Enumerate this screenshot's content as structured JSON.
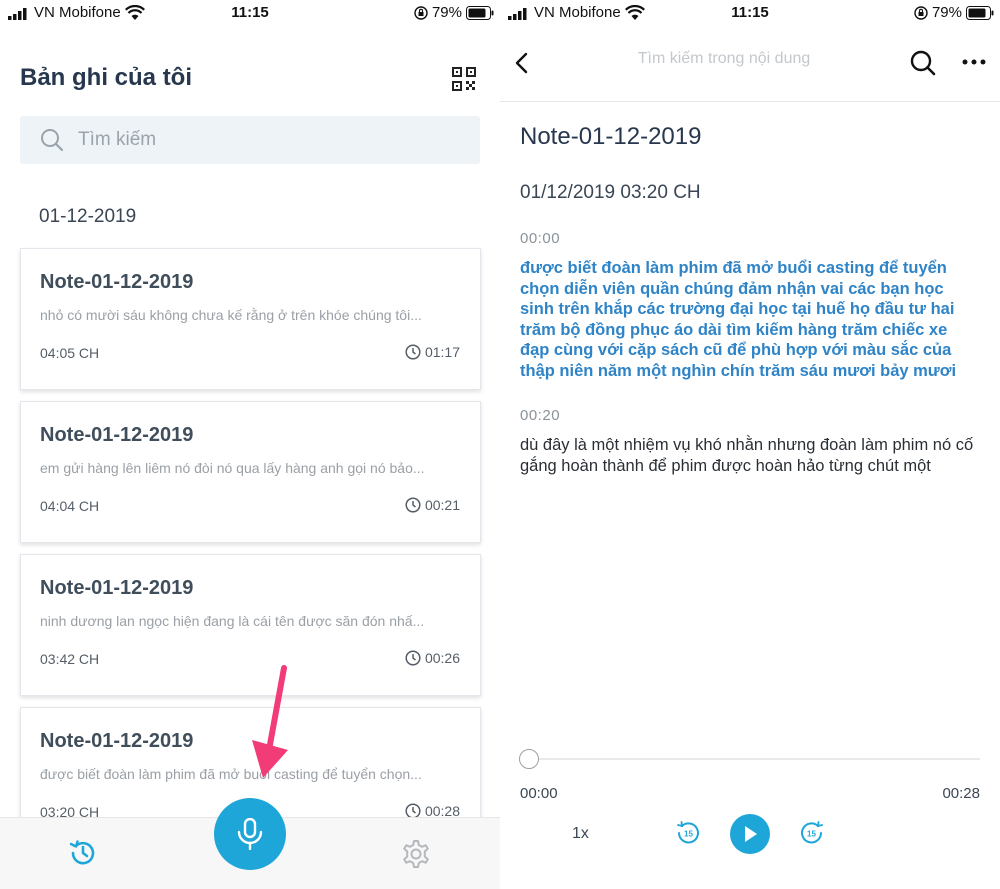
{
  "status_left": {
    "carrier": "VN Mobifone",
    "time": "11:15",
    "battery": "79%"
  },
  "status_right": {
    "carrier": "VN Mobifone",
    "time": "11:15",
    "battery": "79%"
  },
  "list_screen": {
    "title": "Bản ghi của tôi",
    "search_placeholder": "Tìm kiếm",
    "date_group": "01-12-2019",
    "notes": [
      {
        "title": "Note-01-12-2019",
        "snippet": "nhỏ có mười sáu không chưa kế rằng ở trên khóe chúng tôi...",
        "time": "04:05 CH",
        "duration": "01:17"
      },
      {
        "title": "Note-01-12-2019",
        "snippet": "em gửi hàng lên liêm nó đòi nó qua lấy hàng anh gọi nó bảo...",
        "time": "04:04 CH",
        "duration": "00:21"
      },
      {
        "title": "Note-01-12-2019",
        "snippet": "ninh dương lan ngọc hiện đang là cái tên được săn đón nhấ...",
        "time": "03:42 CH",
        "duration": "00:26"
      },
      {
        "title": "Note-01-12-2019",
        "snippet": "được biết đoàn làm phim đã mở buổi casting để tuyển chọn...",
        "time": "03:20 CH",
        "duration": "00:28"
      }
    ]
  },
  "detail_screen": {
    "search_placeholder": "Tìm kiếm trong nội dung",
    "title": "Note-01-12-2019",
    "datetime": "01/12/2019 03:20 CH",
    "segments": [
      {
        "timestamp": "00:00",
        "text": "được biết đoàn làm phim đã mở buổi casting để tuyển chọn diễn viên quần chúng đảm nhận vai các bạn học sinh trên khắp các trường đại học tại huế họ đầu tư hai trăm bộ đồng phục áo dài tìm kiếm hàng trăm chiếc xe đạp cùng với cặp sách cũ để phù hợp với màu sắc của thập niên năm một nghìn chín trăm sáu mươi bảy mươi",
        "active": true
      },
      {
        "timestamp": "00:20",
        "text": "dù đây là một nhiệm vụ khó nhằn nhưng đoàn làm phim nó cố gắng hoàn thành để phim được hoàn hảo từng chút một",
        "active": false
      }
    ],
    "player": {
      "current": "00:00",
      "total": "00:28",
      "speed": "1x",
      "skip_back": "15",
      "skip_forward": "15",
      "progress": 0
    }
  },
  "colors": {
    "accent": "#1ea6d8",
    "highlight_text": "#2f84c7",
    "title_text": "#27374d",
    "arrow": "#f23c78"
  }
}
